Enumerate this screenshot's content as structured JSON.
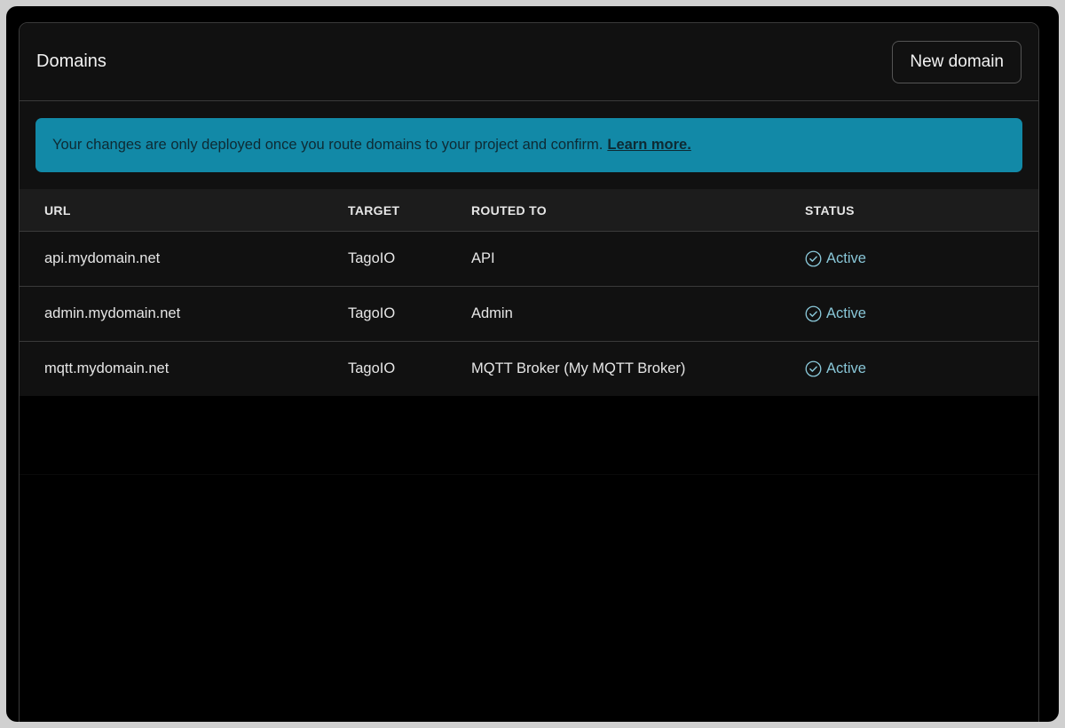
{
  "header": {
    "title": "Domains",
    "new_button_label": "New domain"
  },
  "banner": {
    "text": "Your changes are only deployed once you route domains to your project and confirm.",
    "link_label": "Learn more."
  },
  "table": {
    "columns": {
      "url": "URL",
      "target": "TARGET",
      "routed_to": "ROUTED TO",
      "status": "STATUS"
    },
    "rows": [
      {
        "url": "api.mydomain.net",
        "target": "TagoIO",
        "routed_to": "API",
        "status": "Active"
      },
      {
        "url": "admin.mydomain.net",
        "target": "TagoIO",
        "routed_to": "Admin",
        "status": "Active"
      },
      {
        "url": "mqtt.mydomain.net",
        "target": "TagoIO",
        "routed_to": "MQTT Broker (My MQTT Broker)",
        "status": "Active"
      }
    ]
  },
  "colors": {
    "banner": "#1289a7",
    "status_active": "#89c7d8",
    "panel_bg": "#111111"
  },
  "icons": {
    "status": "check-circle-icon"
  }
}
